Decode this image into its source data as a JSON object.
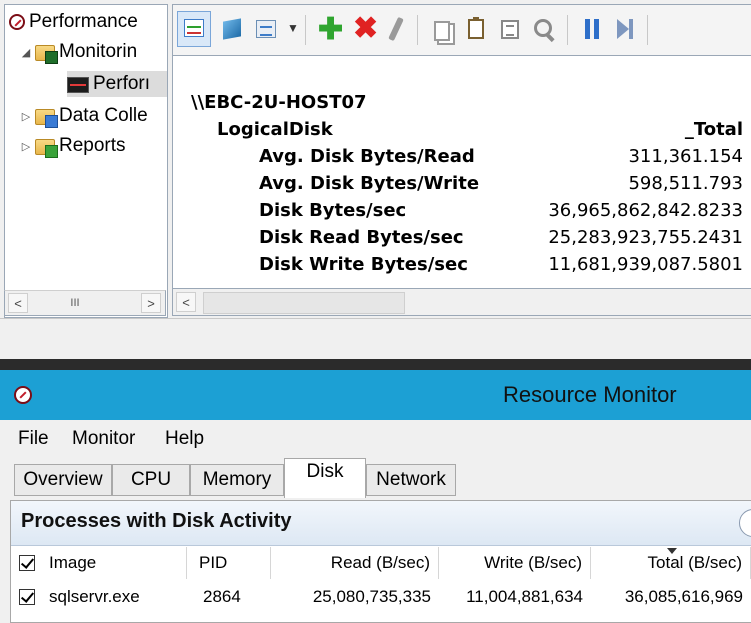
{
  "perfmon": {
    "tree": {
      "items": [
        {
          "label": "Performance",
          "icon": "performance-icon"
        },
        {
          "label": "Monitorin",
          "icon": "monitoring-tools-folder-icon"
        },
        {
          "label": "Perforı",
          "icon": "performance-monitor-graph-icon"
        },
        {
          "label": "Data Colle",
          "icon": "data-collector-folder-icon"
        },
        {
          "label": "Reports",
          "icon": "reports-folder-icon"
        }
      ]
    },
    "toolbar": {
      "icons": [
        "view-graph-icon",
        "view-histogram-icon",
        "change-graph-type-icon",
        "dropdown-arrow-icon",
        "add-counter-icon",
        "delete-counter-icon",
        "highlight-icon",
        "copy-properties-icon",
        "paste-counter-list-icon",
        "properties-icon",
        "zoom-icon",
        "freeze-display-icon",
        "update-data-icon"
      ]
    },
    "report": {
      "host": "\\\\EBC-2U-HOST07",
      "object": "LogicalDisk",
      "instance": "_Total",
      "counters": [
        {
          "name": "Avg. Disk Bytes/Read",
          "value": "311,361.154"
        },
        {
          "name": "Avg. Disk Bytes/Write",
          "value": "598,511.793"
        },
        {
          "name": "Disk Bytes/sec",
          "value": "36,965,862,842.8233"
        },
        {
          "name": "Disk Read Bytes/sec",
          "value": "25,283,923,755.2431"
        },
        {
          "name": "Disk Write Bytes/sec",
          "value": "11,681,939,087.5801"
        }
      ]
    },
    "scroll": {
      "left": "<",
      "right": ">",
      "thumb": "III"
    }
  },
  "resmon": {
    "title": "Resource Monitor",
    "menu": [
      "File",
      "Monitor",
      "Help"
    ],
    "tabs": [
      "Overview",
      "CPU",
      "Memory",
      "Disk",
      "Network"
    ],
    "active_tab": "Disk",
    "panel": {
      "title": "Processes with Disk Activity",
      "collapse_glyph": "‹",
      "columns": [
        "Image",
        "PID",
        "Read (B/sec)",
        "Write (B/sec)",
        "Total (B/sec)"
      ],
      "rows": [
        {
          "image": "sqlservr.exe",
          "pid": "2864",
          "read": "25,080,735,335",
          "write": "11,004,881,634",
          "total": "36,085,616,969"
        }
      ]
    }
  }
}
